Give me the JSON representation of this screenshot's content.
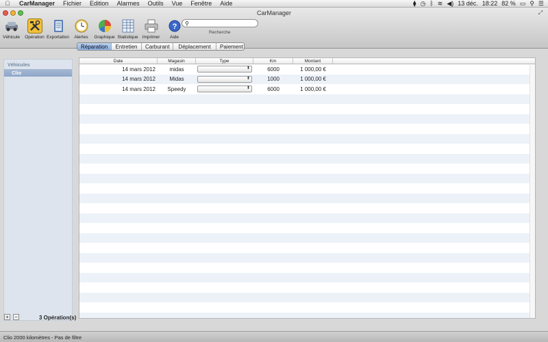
{
  "menubar": {
    "app_name": "CarManager",
    "items": [
      "Fichier",
      "Edition",
      "Alarmes",
      "Outils",
      "Vue",
      "Fenêtre",
      "Aide"
    ],
    "date": "13 déc.",
    "time": "18:22",
    "battery": "82 %"
  },
  "window": {
    "title": "CarManager"
  },
  "toolbar": {
    "items": [
      {
        "label": "Véhicule",
        "icon": "car-icon",
        "color": "#7a8696"
      },
      {
        "label": "Opération",
        "icon": "tools-icon",
        "color": "#f2c038"
      },
      {
        "label": "Exportation",
        "icon": "notebook-icon",
        "color": "#5a7fb6"
      },
      {
        "label": "Alertes",
        "icon": "clock-icon",
        "color": "#e8b43a"
      },
      {
        "label": "Graphique",
        "icon": "pie-chart-icon",
        "color": "#e0433a"
      },
      {
        "label": "Statistique",
        "icon": "table-icon",
        "color": "#cdd9ea"
      },
      {
        "label": "Imprimer",
        "icon": "printer-icon",
        "color": "#bfbfbf"
      },
      {
        "label": "Aide",
        "icon": "help-icon",
        "color": "#3a67c9"
      }
    ],
    "search": {
      "placeholder": "",
      "label": "Recherche"
    }
  },
  "sidebar": {
    "group": "Véhicules",
    "items": [
      {
        "label": "Clio",
        "selected": true
      }
    ],
    "add": "+",
    "remove": "−",
    "count": "3 Opération(s)"
  },
  "tabs": {
    "items": [
      "Réparation",
      "Entretien",
      "Carburant",
      "Déplacement",
      "Paiement"
    ],
    "selected": "Réparation"
  },
  "table": {
    "columns": [
      "Date",
      "Magasin",
      "Type",
      "Km",
      "Montant"
    ],
    "rows": [
      {
        "date": "14 mars 2012",
        "magasin": "midas",
        "type": "",
        "km": "6000",
        "montant": "1 000,00 €"
      },
      {
        "date": "14 mars 2012",
        "magasin": "Midas",
        "type": "",
        "km": "1000",
        "montant": "1 000,00 €"
      },
      {
        "date": "14 mars 2012",
        "magasin": "Speedy",
        "type": "",
        "km": "6000",
        "montant": "1 000,00 €"
      }
    ]
  },
  "status": {
    "text": "Clio 2000 kilomètres - Pas de filtre"
  }
}
